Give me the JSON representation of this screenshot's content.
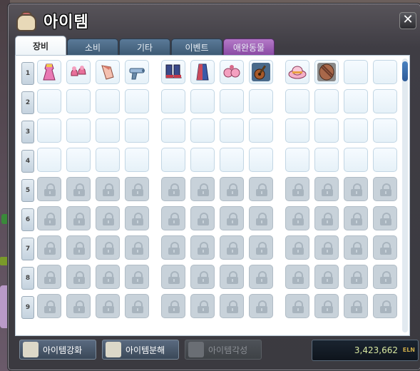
{
  "window": {
    "title": "아이템",
    "close_label": "✕"
  },
  "tabs": [
    {
      "label": "장비",
      "active": true
    },
    {
      "label": "소비",
      "active": false
    },
    {
      "label": "기타",
      "active": false
    },
    {
      "label": "이벤트",
      "active": false
    },
    {
      "label": "애완동물",
      "active": false
    }
  ],
  "rows": [
    {
      "num": "1",
      "state": "items"
    },
    {
      "num": "2",
      "state": "empty"
    },
    {
      "num": "3",
      "state": "empty"
    },
    {
      "num": "4",
      "state": "empty"
    },
    {
      "num": "5",
      "state": "locked"
    },
    {
      "num": "6",
      "state": "locked"
    },
    {
      "num": "7",
      "state": "locked"
    },
    {
      "num": "8",
      "state": "locked"
    },
    {
      "num": "9",
      "state": "locked"
    }
  ],
  "row1_items": [
    "pink-dress-icon",
    "pink-shoes-icon",
    "pink-gloves-icon",
    "pistol-icon",
    "dark-boots-icon",
    "blue-outfit-icon",
    "pink-earrings-icon",
    "guitar-icon",
    "pink-hat-icon",
    "shield-icon",
    "",
    ""
  ],
  "buttons": {
    "enhance": "아이템강화",
    "disassemble": "아이템분해",
    "awaken": "아이템각성"
  },
  "meso": {
    "value": "3,423,662",
    "unit": "ELN"
  },
  "colors": {
    "active_tab": "#ffffff",
    "tab": "#4a6a88",
    "pet_tab": "#9a5ab4",
    "slot": "#eef6fb",
    "locked_slot": "#c8d2da"
  }
}
